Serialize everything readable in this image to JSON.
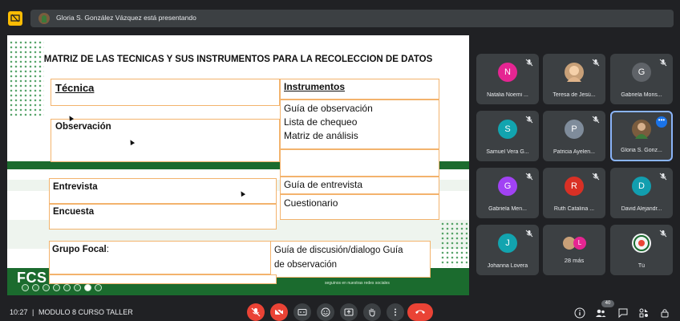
{
  "presenter_banner": {
    "text": "Gloria S. González Vázquez está presentando"
  },
  "slide": {
    "title": "MATRIZ  DE LAS TECNICAS  Y SUS INSTRUMENTOS PARA LA RECOLECCION DE DATOS",
    "header_tecnica": "Técnica",
    "header_instrumentos": "Instrumentos",
    "observacion": "Observación",
    "obs_instrumento_1": "Guía de observación",
    "obs_instrumento_2": "Lista de chequeo",
    "obs_instrumento_3": "Matriz de análisis",
    "entrevista": "Entrevista",
    "entrevista_instrumento": "Guía de entrevista",
    "encuesta": "Encuesta",
    "encuesta_instrumento": "Cuestionario",
    "grupo_focal": "Grupo Focal",
    "grupo_focal_colon": ":",
    "grupo_focal_instrumento_1": "Guía de   discusión/dialogo Guía",
    "grupo_focal_instrumento_2": "de observación",
    "logo": "FCS",
    "footer": "seguinos en nuestras redes sociales"
  },
  "participants": [
    {
      "name": "Natalia Noemi ...",
      "initial": "N",
      "color": "#e52592"
    },
    {
      "name": "Teresa de Jesú...",
      "initial": "",
      "color": "#c8a078"
    },
    {
      "name": "Gabriela Mons...",
      "initial": "G",
      "color": "#5f6368"
    },
    {
      "name": "Samuel Vera G...",
      "initial": "S",
      "color": "#12a4af"
    },
    {
      "name": "Patricia Ayelen...",
      "initial": "P",
      "color": "#7f8c9b"
    },
    {
      "name": "Gloria S. Gonz...",
      "initial": "",
      "color": "#7a5c3e"
    },
    {
      "name": "Gabriela Men...",
      "initial": "G",
      "color": "#a142f4"
    },
    {
      "name": "Ruth Catalina ...",
      "initial": "R",
      "color": "#d93025"
    },
    {
      "name": "David Alejandr...",
      "initial": "D",
      "color": "#129eaf"
    },
    {
      "name": "Johanna Lovera",
      "initial": "J",
      "color": "#12a4af"
    },
    {
      "name": "28 más",
      "initial": "L",
      "color": "#e52592"
    },
    {
      "name": "Tú",
      "initial": "",
      "color": "#f1f3f4"
    }
  ],
  "bottom_bar": {
    "time": "10:27",
    "separator": "|",
    "meeting": "MODULO 8 CURSO TALLER",
    "participant_count": "40"
  },
  "colors": {
    "background": "#202124",
    "tile": "#3c4043",
    "end_call": "#ea4335",
    "slide_green": "#1b6b2e",
    "cell_border": "#f3b36d",
    "accent": "#8ab4f8"
  }
}
